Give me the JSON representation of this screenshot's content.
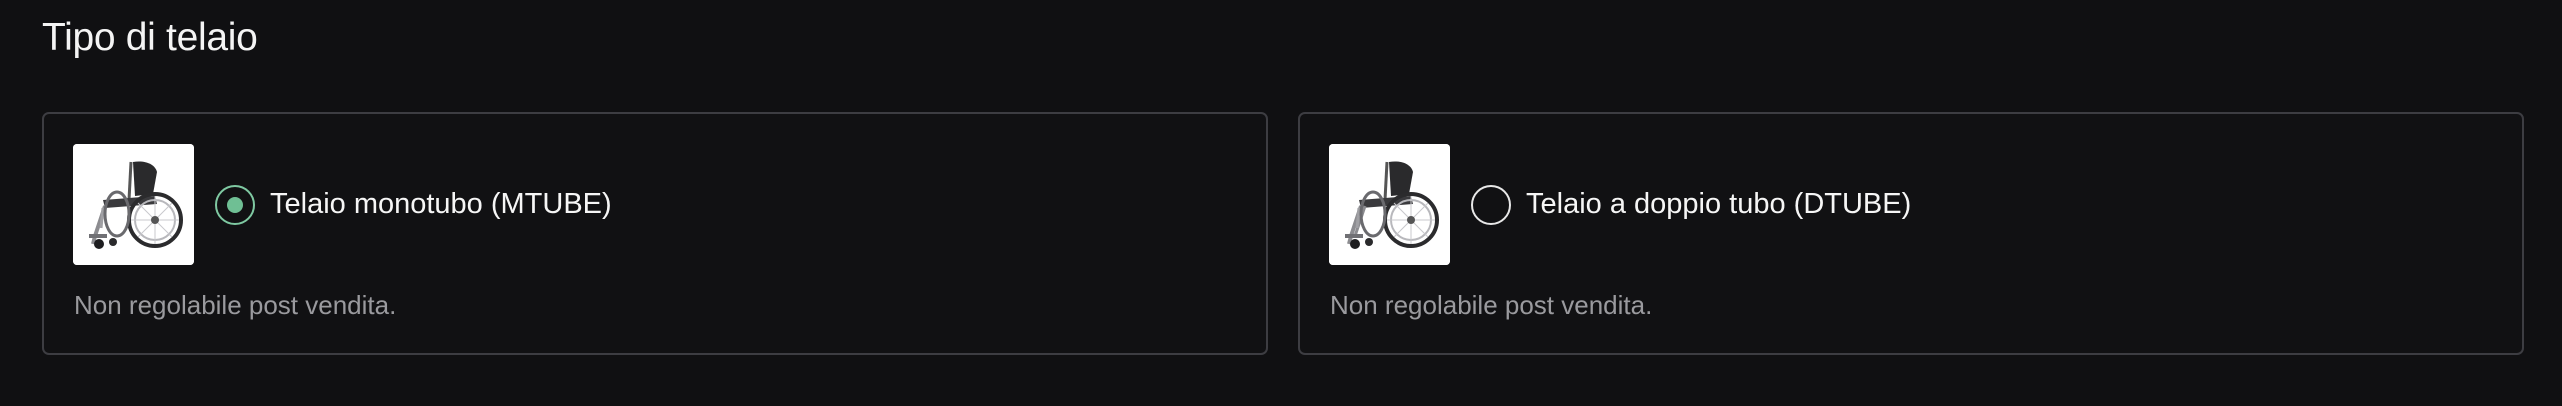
{
  "section": {
    "title": "Tipo di telaio"
  },
  "options": [
    {
      "label": "Telaio monotubo (MTUBE)",
      "note": "Non regolabile post vendita.",
      "selected": true,
      "image": "wheelchair-thumbnail"
    },
    {
      "label": "Telaio a doppio tubo (DTUBE)",
      "note": "Non regolabile post vendita.",
      "selected": false,
      "image": "wheelchair-thumbnail"
    }
  ],
  "colors": {
    "background": "#101012",
    "card_border": "#3d3d42",
    "radio_selected": "#6fbf94",
    "note_text": "#9a9a9e"
  }
}
